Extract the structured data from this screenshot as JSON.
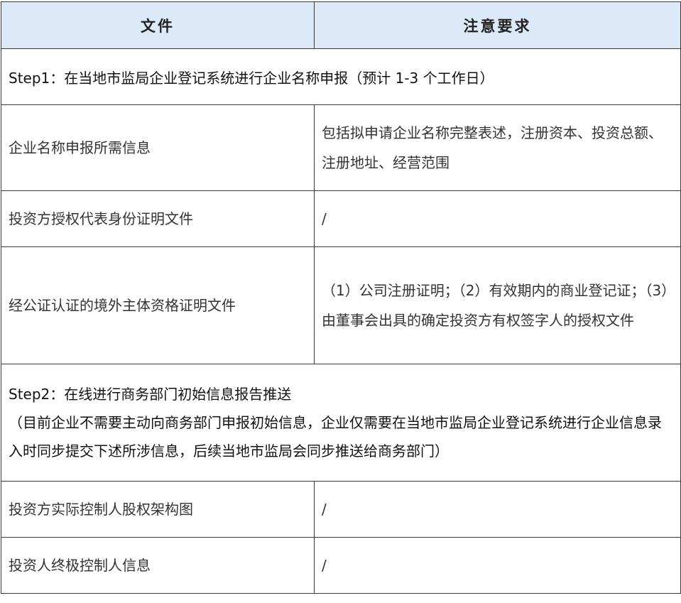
{
  "header": {
    "col1": "文件",
    "col2": "注意要求"
  },
  "rows": [
    {
      "type": "step",
      "text": "Step1：在当地市监局企业登记系统进行企业名称申报（预计 1-3 个工作日）"
    },
    {
      "type": "item",
      "doc": "企业名称申报所需信息",
      "req": "包括拟申请企业名称完整表述，注册资本、投资总额、注册地址、经营范围"
    },
    {
      "type": "item",
      "doc": "投资方授权代表身份证明文件",
      "req": "/"
    },
    {
      "type": "item",
      "doc": "经公证认证的境外主体资格证明文件",
      "req": "（1）公司注册证明；（2）有效期内的商业登记证；（3）由董事会出具的确定投资方有权签字人的授权文件"
    },
    {
      "type": "step",
      "text": "Step2：在线进行商务部门初始信息报告推送",
      "note": "（目前企业不需要主动向商务部门申报初始信息，企业仅需要在当地市监局企业登记系统进行企业信息录入时同步提交下述所涉信息，后续当地市监局会同步推送给商务部门）"
    },
    {
      "type": "item",
      "doc": "投资方实际控制人股权架构图",
      "req": "/"
    },
    {
      "type": "item",
      "doc": "投资人终极控制人信息",
      "req": "/"
    }
  ]
}
